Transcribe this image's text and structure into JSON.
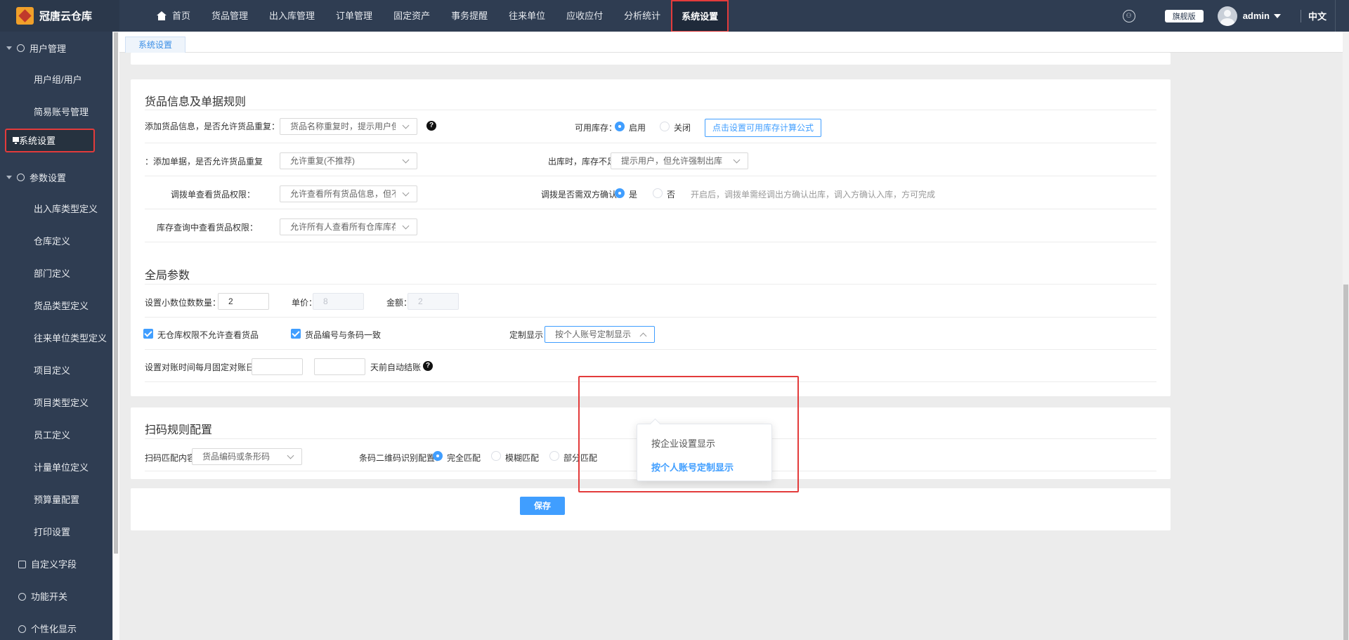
{
  "app": {
    "logo_text": "冠唐云仓库"
  },
  "topnav": {
    "home": "首页",
    "items": [
      "货品管理",
      "出入库管理",
      "订单管理",
      "固定资产",
      "事务提醒",
      "往来单位",
      "应收应付",
      "分析统计"
    ],
    "active": "系统设置"
  },
  "topright": {
    "edition": "旗舰版",
    "user": "admin",
    "lang": "中文"
  },
  "sidebar": {
    "user_mgmt": "用户管理",
    "user_group": "用户组/用户",
    "simple_account": "简易账号管理",
    "system_settings": "系统设置",
    "param_settings": "参数设置",
    "param_items": [
      "出入库类型定义",
      "仓库定义",
      "部门定义",
      "货品类型定义",
      "往来单位类型定义",
      "项目定义",
      "项目类型定义",
      "员工定义",
      "计量单位定义",
      "预算量配置",
      "打印设置"
    ],
    "custom_fields": "自定义字段",
    "feature_switch": "功能开关",
    "personal_display": "个性化显示"
  },
  "tabs": {
    "active": "系统设置"
  },
  "goods_rules": {
    "title": "货品信息及单据规则",
    "dup_goods_label": "添加货品信息，是否允许货品重复：",
    "dup_goods_value": "货品名称重复时，提示用户但允许添",
    "avail_stock_label": "可用库存：",
    "avail_on": "启用",
    "avail_off": "关闭",
    "avail_formula_btn": "点击设置可用库存计算公式",
    "dup_doc_label": "添加单据，是否允许货品重复：",
    "dup_doc_value": "允许重复(不推荐)",
    "outbound_label": "出库时，库存不足：",
    "outbound_value": "提示用户，但允许强制出库",
    "transfer_view_label": "调拨单查看货品权限：",
    "transfer_view_value": "允许查看所有货品信息，但不允许查",
    "transfer_confirm_label": "调拨是否需双方确认：",
    "transfer_yes": "是",
    "transfer_no": "否",
    "transfer_hint": "开启后，调拨单需经调出方确认出库，调入方确认入库，方可完成",
    "stock_query_label": "库存查询中查看货品权限：",
    "stock_query_value": "允许所有人查看所有仓库库存"
  },
  "global_params": {
    "title": "全局参数",
    "decimals_label": "设置小数位数",
    "qty_label": "数量：",
    "qty_value": "2",
    "price_label": "单价：",
    "price_value": "8",
    "amount_label": "金额：",
    "amount_value": "2",
    "no_wh_perm": "无仓库权限不允许查看货品",
    "code_barcode": "货品编号与条码一致",
    "custom_display_label": "定制显示：",
    "custom_display_value": "按个人账号定制显示",
    "dropdown_options": [
      "按企业设置显示",
      "按个人账号定制显示"
    ],
    "recon_label": "设置对账时间",
    "recon_day_label": "每月固定对账日：",
    "recon_day_value": "",
    "auto_close_value": "",
    "auto_close_label": "天前自动结账"
  },
  "scan_rules": {
    "title": "扫码规则配置",
    "match_label": "扫码匹配内容：",
    "match_value": "货品编码或条形码",
    "barcode_label": "条码二维码识别配置：",
    "exact": "完全匹配",
    "fuzzy": "模糊匹配",
    "partial": "部分匹配"
  },
  "footer": {
    "save": "保存"
  },
  "colors": {
    "topbar": "#2f3d52",
    "accent": "#409eff",
    "highlight": "#e33b3b"
  }
}
